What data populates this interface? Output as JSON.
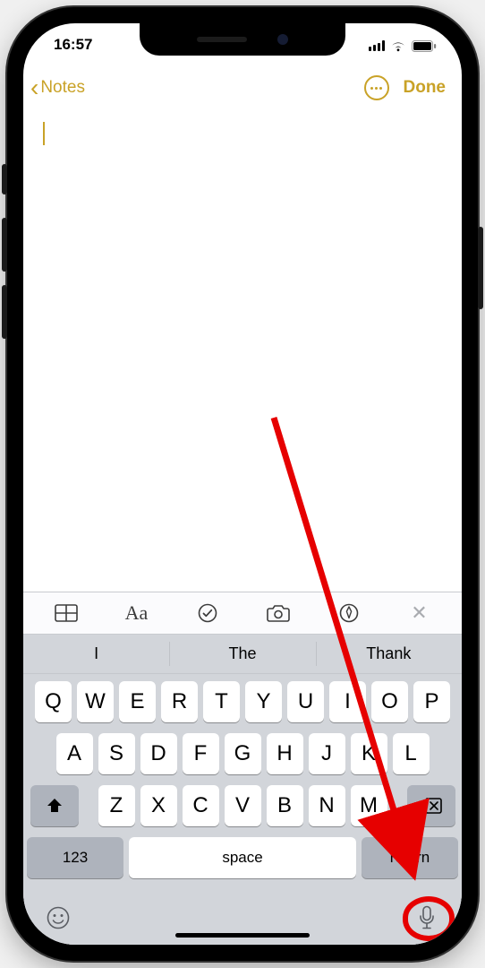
{
  "status": {
    "time": "16:57"
  },
  "nav": {
    "back_label": "Notes",
    "done_label": "Done"
  },
  "note": {
    "content": ""
  },
  "toolbar": {
    "close_label": "✕"
  },
  "suggestions": [
    "I",
    "The",
    "Thank"
  ],
  "keyboard": {
    "row1": [
      "Q",
      "W",
      "E",
      "R",
      "T",
      "Y",
      "U",
      "I",
      "O",
      "P"
    ],
    "row2": [
      "A",
      "S",
      "D",
      "F",
      "G",
      "H",
      "J",
      "K",
      "L"
    ],
    "row3": [
      "Z",
      "X",
      "C",
      "V",
      "B",
      "N",
      "M"
    ],
    "numbers_label": "123",
    "space_label": "space",
    "return_label": "return"
  }
}
